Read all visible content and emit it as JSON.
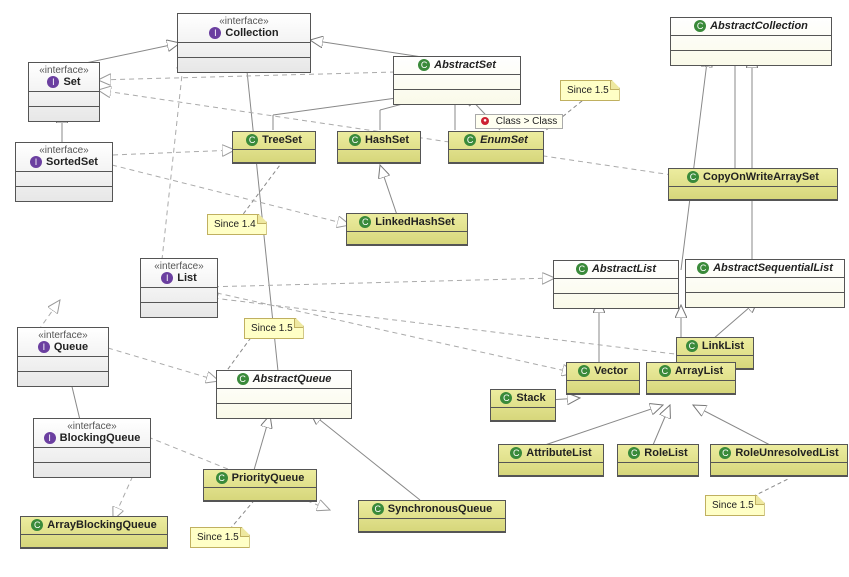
{
  "stereotype": "«interface»",
  "icons": {
    "i": "I",
    "c": "C",
    "r": "●"
  },
  "interfaces": {
    "collection": "Collection",
    "set": "Set",
    "sortedset": "SortedSet",
    "list": "List",
    "queue": "Queue",
    "blockingqueue": "BlockingQueue"
  },
  "abstracts": {
    "abstractcollection": "AbstractCollection",
    "abstractset": "AbstractSet",
    "abstractlist": "AbstractList",
    "abstractsequentiallist": "AbstractSequentialList",
    "abstractqueue": "AbstractQueue"
  },
  "classes": {
    "treeset": "TreeSet",
    "hashset": "HashSet",
    "enumset": "EnumSet",
    "linkedhashset": "LinkedHashSet",
    "copyonwritearrayset": "CopyOnWriteArraySet",
    "linklist": "LinkList",
    "vector": "Vector",
    "arraylist": "ArrayList",
    "stack": "Stack",
    "attributelist": "AttributeList",
    "rolelist": "RoleList",
    "roleunresolvedlist": "RoleUnresolvedList",
    "priorityqueue": "PriorityQueue",
    "synchronousqueue": "SynchronousQueue",
    "arrayblockingqueue": "ArrayBlockingQueue"
  },
  "notes": {
    "n1": "Since 1.5",
    "n2": "Since 1.4",
    "n3": "Since 1.5",
    "n4": "Since 1.5",
    "n5": "Since 1.5"
  },
  "tooltip": "Class > Class"
}
